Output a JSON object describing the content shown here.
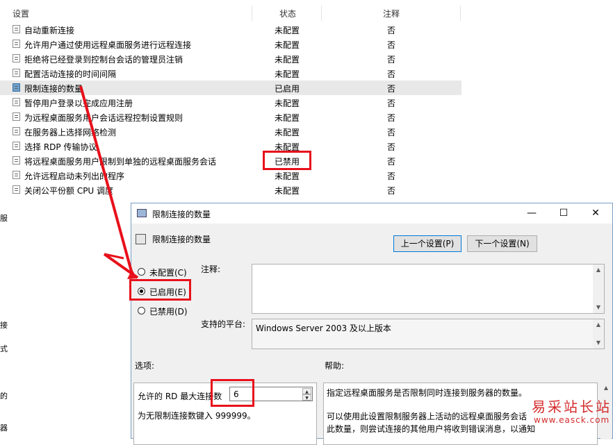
{
  "list": {
    "headers": {
      "setting": "设置",
      "state": "状态",
      "comment": "注释"
    },
    "rows": [
      {
        "name": "自动重新连接",
        "state": "未配置",
        "comment": "否"
      },
      {
        "name": "允许用户通过使用远程桌面服务进行远程连接",
        "state": "未配置",
        "comment": "否"
      },
      {
        "name": "拒绝将已经登录到控制台会话的管理员注销",
        "state": "未配置",
        "comment": "否"
      },
      {
        "name": "配置活动连接的时间间隔",
        "state": "未配置",
        "comment": "否"
      },
      {
        "name": "限制连接的数量",
        "state": "已启用",
        "comment": "否"
      },
      {
        "name": "暂停用户登录以完成应用注册",
        "state": "未配置",
        "comment": "否"
      },
      {
        "name": "为远程桌面服务用户会话远程控制设置规则",
        "state": "未配置",
        "comment": "否"
      },
      {
        "name": "在服务器上选择网络检测",
        "state": "未配置",
        "comment": "否"
      },
      {
        "name": "选择 RDP 传输协议",
        "state": "未配置",
        "comment": "否"
      },
      {
        "name": "将远程桌面服务用户限制到单独的远程桌面服务会话",
        "state": "已禁用",
        "comment": "否"
      },
      {
        "name": "允许远程启动未列出的程序",
        "state": "未配置",
        "comment": "否"
      },
      {
        "name": "关闭公平份额 CPU 调度",
        "state": "未配置",
        "comment": "否"
      }
    ]
  },
  "left_edge": [
    "服",
    "接",
    "式",
    "的",
    "器"
  ],
  "dialog": {
    "title": "限制连接的数量",
    "header_title": "限制连接的数量",
    "prev_button": "上一个设置(P)",
    "next_button": "下一个设置(N)",
    "radio_not_configured": "未配置(C)",
    "radio_enabled": "已启用(E)",
    "radio_disabled": "已禁用(D)",
    "selected": "enabled",
    "comment_label": "注释:",
    "comment_value": "",
    "platform_label": "支持的平台:",
    "platform_value": "Windows Server 2003 及以上版本",
    "options_label": "选项:",
    "help_label": "帮助:",
    "max_connections_label": "允许的 RD 最大连接数",
    "max_connections_value": "6",
    "unlimited_hint": "为无限制连接数键入 999999。",
    "help_line1": "指定远程桌面服务是否限制同时连接到服务器的数量。",
    "help_line2": "可以使用此设置限制服务器上活动的远程桌面服务会话",
    "help_line3": "此数量，则尝试连接的其他用户将收到错误消息，以通知"
  },
  "watermark": {
    "cn": "易采站长站",
    "url": "www.easck.com"
  },
  "colors": {
    "highlight": "#e8101b",
    "arrow": "#e8101b",
    "primary_border": "#0078d7"
  },
  "icons": {
    "close": "close-icon",
    "maximize": "maximize-icon",
    "minimize": "minimize-icon",
    "policy": "policy-setting-icon"
  }
}
